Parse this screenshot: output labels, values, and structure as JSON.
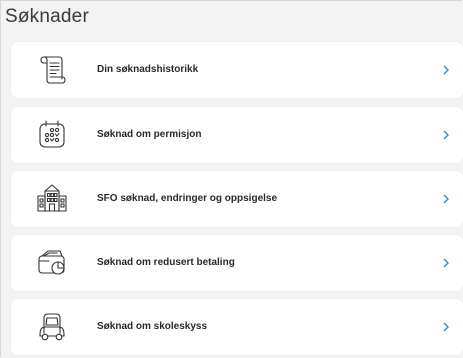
{
  "page": {
    "title": "Søknader"
  },
  "items": [
    {
      "label": "Din søknadshistorikk",
      "icon": "scroll-document-icon"
    },
    {
      "label": "Søknad om permisjon",
      "icon": "calendar-icon"
    },
    {
      "label": "SFO søknad, endringer og oppsigelse",
      "icon": "school-building-icon"
    },
    {
      "label": "Søknad om redusert betaling",
      "icon": "wallet-pie-chart-icon"
    },
    {
      "label": "Søknad om skoleskyss",
      "icon": "car-icon"
    }
  ],
  "colors": {
    "chevron": "#3a8fd6",
    "icon_stroke": "#333333",
    "card_bg": "#ffffff",
    "page_bg": "#f3f3f3"
  }
}
